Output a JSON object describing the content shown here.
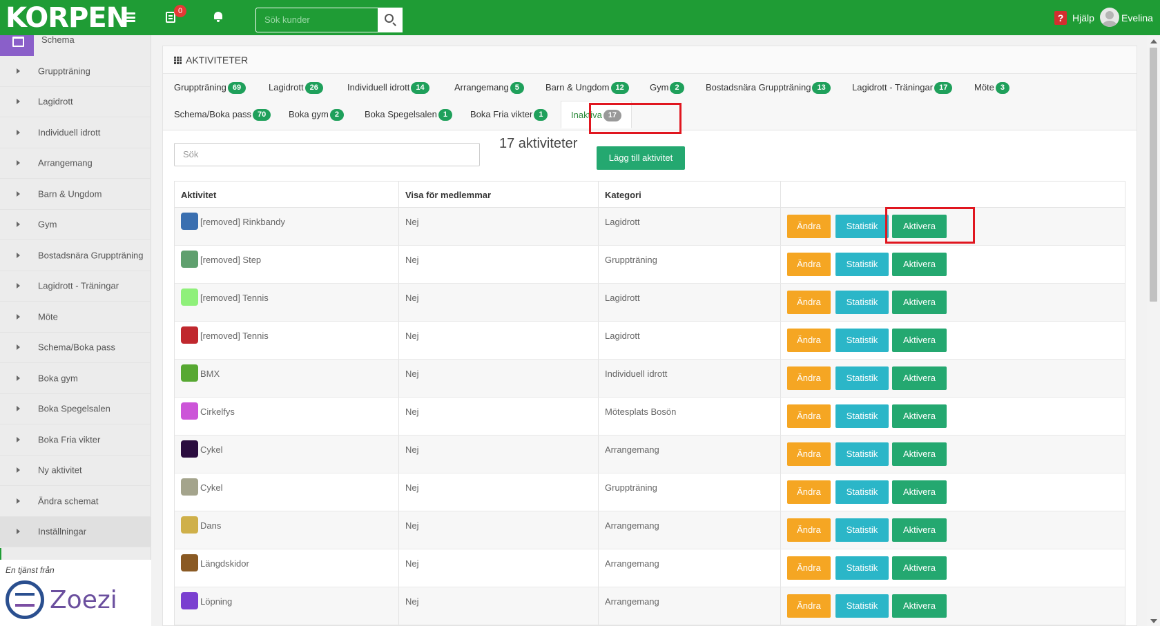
{
  "topbar": {
    "logo": "KORPEN",
    "tasks_badge": "0",
    "search_placeholder": "Sök kunder",
    "help_label": "Hjälp",
    "user_name": "Evelina"
  },
  "sidebar": {
    "schema_label": "Schema",
    "items": [
      {
        "label": "Gruppträning"
      },
      {
        "label": "Lagidrott"
      },
      {
        "label": "Individuell idrott"
      },
      {
        "label": "Arrangemang"
      },
      {
        "label": "Barn & Ungdom"
      },
      {
        "label": "Gym"
      },
      {
        "label": "Bostadsnära Gruppträning"
      },
      {
        "label": "Lagidrott - Träningar"
      },
      {
        "label": "Möte"
      },
      {
        "label": "Schema/Boka pass"
      },
      {
        "label": "Boka gym"
      },
      {
        "label": "Boka Spegelsalen"
      },
      {
        "label": "Boka Fria vikter"
      },
      {
        "label": "Ny aktivitet"
      },
      {
        "label": "Ändra schemat"
      },
      {
        "label": "Inställningar"
      }
    ],
    "footer_service": "En tjänst från",
    "footer_brand": "Zoezi"
  },
  "panel": {
    "title": "AKTIVITETER",
    "tabs": [
      {
        "label": "Gruppträning",
        "count": "69"
      },
      {
        "label": "Lagidrott",
        "count": "26"
      },
      {
        "label": "Individuell idrott",
        "count": "14"
      },
      {
        "label": "Arrangemang",
        "count": "5"
      },
      {
        "label": "Barn & Ungdom",
        "count": "12"
      },
      {
        "label": "Gym",
        "count": "2"
      },
      {
        "label": "Bostadsnära Gruppträning",
        "count": "13"
      },
      {
        "label": "Lagidrott - Träningar",
        "count": "17"
      },
      {
        "label": "Möte",
        "count": "3"
      },
      {
        "label": "Schema/Boka pass",
        "count": "70"
      },
      {
        "label": "Boka gym",
        "count": "2"
      },
      {
        "label": "Boka Spegelsalen",
        "count": "1"
      },
      {
        "label": "Boka Fria vikter",
        "count": "1"
      },
      {
        "label": "Inaktiva",
        "count": "17"
      }
    ],
    "search_placeholder": "Sök",
    "count_text": "17 aktiviteter",
    "add_button": "Lägg till aktivitet",
    "columns": [
      "Aktivitet",
      "Visa för medlemmar",
      "Kategori",
      ""
    ],
    "buttons": {
      "edit": "Ändra",
      "stats": "Statistik",
      "activate": "Aktivera"
    },
    "rows": [
      {
        "name": "[removed] Rinkbandy",
        "show": "Nej",
        "category": "Lagidrott",
        "color": "#3a6fb0"
      },
      {
        "name": "[removed] Step",
        "show": "Nej",
        "category": "Gruppträning",
        "color": "#5fa06e"
      },
      {
        "name": "[removed] Tennis",
        "show": "Nej",
        "category": "Lagidrott",
        "color": "#8ff07a"
      },
      {
        "name": "[removed] Tennis",
        "show": "Nej",
        "category": "Lagidrott",
        "color": "#c0282e"
      },
      {
        "name": "BMX",
        "show": "Nej",
        "category": "Individuell idrott",
        "color": "#57a832"
      },
      {
        "name": "Cirkelfys",
        "show": "Nej",
        "category": "Mötesplats Bosön",
        "color": "#cc55d8"
      },
      {
        "name": "Cykel",
        "show": "Nej",
        "category": "Arrangemang",
        "color": "#2b0d3f"
      },
      {
        "name": "Cykel",
        "show": "Nej",
        "category": "Gruppträning",
        "color": "#a4a48c"
      },
      {
        "name": "Dans",
        "show": "Nej",
        "category": "Arrangemang",
        "color": "#cfb04a"
      },
      {
        "name": "Längdskidor",
        "show": "Nej",
        "category": "Arrangemang",
        "color": "#8a5a24"
      },
      {
        "name": "Löpning",
        "show": "Nej",
        "category": "Arrangemang",
        "color": "#7a3fd0"
      }
    ]
  }
}
